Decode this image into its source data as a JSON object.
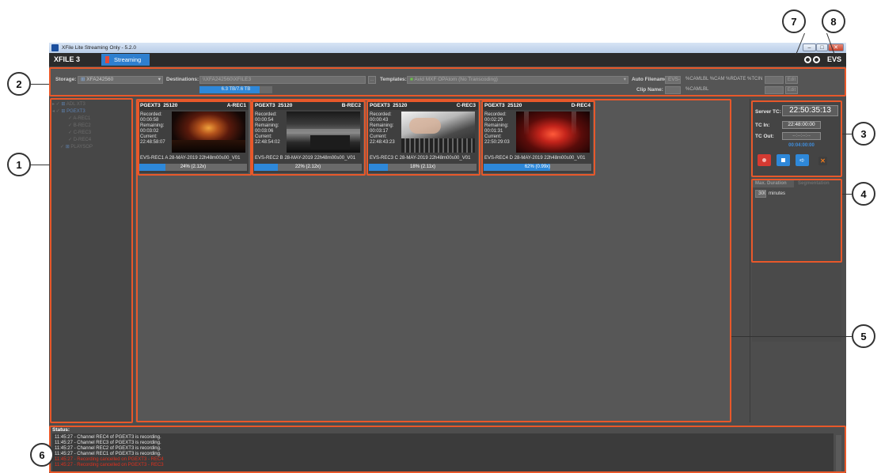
{
  "window": {
    "title": "XFile Lite Streaming Only - 5.2.0",
    "brand": "XFILE 3",
    "tab": "Streaming",
    "logo": "EVS",
    "buttons": [
      "minimize",
      "maximize",
      "close"
    ]
  },
  "settings": {
    "storage_label": "Storage:",
    "storage_value": "XFA242560",
    "destinations_label": "Destinations:",
    "destinations_value": "\\\\XFA242560\\XFILE3",
    "capacity": "6.3 TB/7.6 TB",
    "capacity_fill": 0.83,
    "browse": "...",
    "templates_label": "Templates:",
    "templates_value": "Avid MXF OPAtom (No Transcoding)",
    "auto_filename_label": "Auto Filename:",
    "auto_filename_value": "EVS-",
    "auto_filename_pattern": "%CAMLBL %CAM %RDATE %TCIN",
    "clip_name_label": "Clip Name:",
    "clip_name_pattern": "%CAMLBL",
    "edit": "Edit"
  },
  "tree": {
    "items": [
      {
        "label": "ADL XT3",
        "indent": 0
      },
      {
        "label": "PGEXT3",
        "indent": 0
      },
      {
        "label": "A-REC1",
        "indent": 1
      },
      {
        "label": "B-REC2",
        "indent": 1
      },
      {
        "label": "C-REC3",
        "indent": 1
      },
      {
        "label": "D-REC4",
        "indent": 1
      },
      {
        "label": "PLAYSOP",
        "indent": 0
      }
    ]
  },
  "cards": [
    {
      "server": "PGEXT3",
      "port": "25120",
      "channel": "A-REC1",
      "recorded": "00:00:58",
      "remaining": "00:03:02",
      "current": "22:48:58:07",
      "clip": "EVS-REC1 A 28-MAY-2019 22h48m00s00_V01",
      "progress": 0.24,
      "progress_text": "24% (2.12x)"
    },
    {
      "server": "PGEXT3",
      "port": "25120",
      "channel": "B-REC2",
      "recorded": "00:00:54",
      "remaining": "00:03:06",
      "current": "22:48:54:02",
      "clip": "EVS-REC2 B 28-MAY-2019 22h48m00s00_V01",
      "progress": 0.22,
      "progress_text": "22% (2.12x)"
    },
    {
      "server": "PGEXT3",
      "port": "25120",
      "channel": "C-REC3",
      "recorded": "00:00:43",
      "remaining": "00:03:17",
      "current": "22:48:43:23",
      "clip": "EVS-REC3 C 28-MAY-2019 22h48m00s00_V01",
      "progress": 0.18,
      "progress_text": "18% (2.11x)"
    },
    {
      "server": "PGEXT3",
      "port": "25120",
      "channel": "D-REC4",
      "recorded": "00:02:29",
      "remaining": "00:01:31",
      "current": "22:50:29:03",
      "clip": "EVS-REC4 D 28-MAY-2019 22h48m00s00_V01",
      "progress": 0.62,
      "progress_text": "62% (0.99x)"
    }
  ],
  "card_labels": {
    "recorded": "Recorded:",
    "remaining": "Remaining:",
    "current": "Current:"
  },
  "recorder": {
    "server_tc_label": "Server TC:",
    "server_tc": "22:50:35:13",
    "tc_in_label": "TC In:",
    "tc_in": "22:48:00:00",
    "tc_out_label": "TC Out:",
    "tc_out": "--:--:--:--",
    "duration": "00:04:00:00"
  },
  "duration": {
    "tab_max": "Max. Duration",
    "tab_seg": "Segmentation",
    "value": "300",
    "unit": "minutes"
  },
  "status": {
    "title": "Status:",
    "log": [
      {
        "text": "11:45:27 - Channel REC4 of PGEXT3 is recording.",
        "error": false
      },
      {
        "text": "11:45:27 - Channel REC3 of PGEXT3 is recording.",
        "error": false
      },
      {
        "text": "11:45:27 - Channel REC2 of PGEXT3 is recording.",
        "error": false
      },
      {
        "text": "11:45:27 - Channel REC1 of PGEXT3 is recording.",
        "error": false
      },
      {
        "text": "11:45:27 - Recording cancelled on PGEXT3 - REC4",
        "error": true
      },
      {
        "text": "11:45:27 - Recording cancelled on PGEXT3 - REC3",
        "error": true
      }
    ]
  },
  "callouts": [
    "1",
    "2",
    "3",
    "4",
    "5",
    "6",
    "7",
    "8"
  ],
  "colors": {
    "accent": "#2e7fcf",
    "highlight": "#e8582a",
    "record": "#d43a32"
  }
}
